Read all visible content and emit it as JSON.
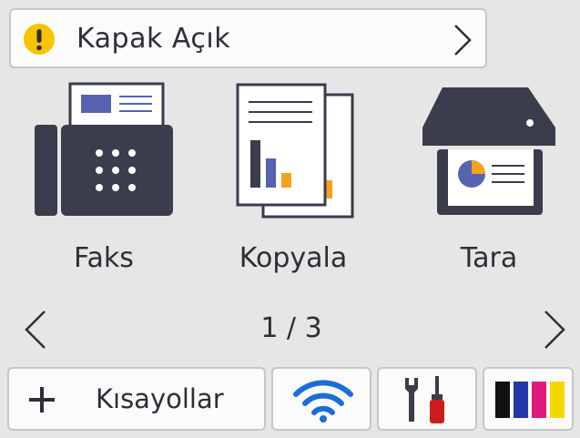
{
  "status": {
    "message": "Kapak Açık",
    "warning_color": "#f6c400"
  },
  "apps": [
    {
      "label": "Faks",
      "icon": "fax-icon"
    },
    {
      "label": "Kopyala",
      "icon": "copy-icon"
    },
    {
      "label": "Tara",
      "icon": "scan-icon"
    }
  ],
  "pager": {
    "text": "1 / 3"
  },
  "bottom_bar": {
    "shortcuts_label": "Kısayollar",
    "shortcuts_icon": "plus-icon",
    "wifi_icon": "wifi-icon",
    "tools_icon": "wrench-screwdriver-icon",
    "ink_icon": "ink-cartridges-icon",
    "ink_colors": [
      "#111111",
      "#2238a8",
      "#e01a7a",
      "#f5d800"
    ]
  },
  "colors": {
    "background": "#e6e6e6",
    "icon_dark": "#3b3c4c",
    "accent_blue": "#5862b3",
    "accent_orange": "#f5a21f",
    "wifi_blue": "#1a6fd6",
    "screwdriver_red": "#cc1c1c"
  }
}
